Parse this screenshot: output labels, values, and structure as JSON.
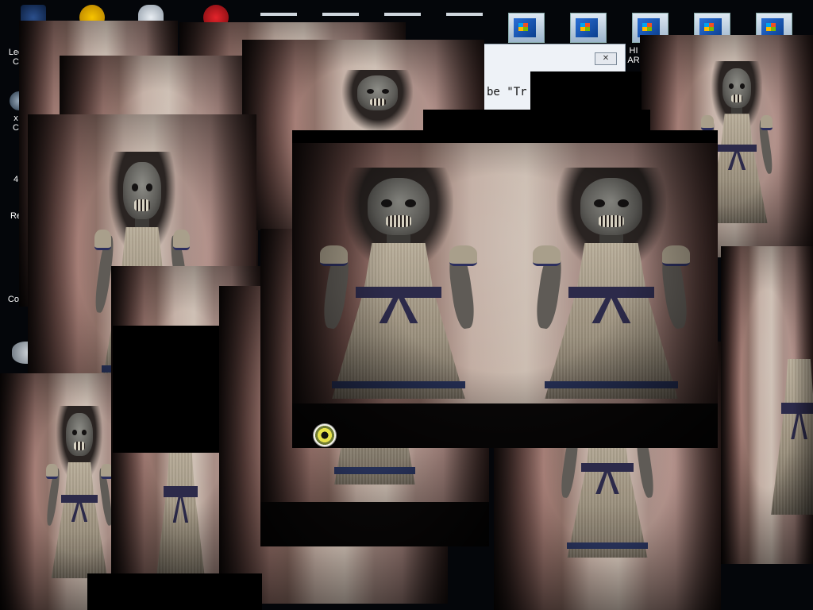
{
  "desktop": {
    "icons": [
      {
        "label": "Lee",
        "label2": "C"
      },
      {
        "label": "x",
        "label2": "C"
      },
      {
        "label": "4",
        "label2": ""
      },
      {
        "label": "Re",
        "label2": ""
      },
      {
        "label": "Con",
        "label2": ""
      }
    ],
    "right_icon": {
      "label": "HI",
      "label2": "AR"
    },
    "top_icon_colors": [
      "#1c3d75",
      "#f7b500",
      "#dfe4ea",
      "#c0141c"
    ]
  },
  "dialog": {
    "close_symbol": "✕",
    "text": "be \"Tr"
  },
  "taskbar_windows": [
    "window-1",
    "window-2",
    "window-3",
    "window-4",
    "window-5"
  ],
  "cursor": {
    "icon": "eyeball-cursor-icon"
  }
}
